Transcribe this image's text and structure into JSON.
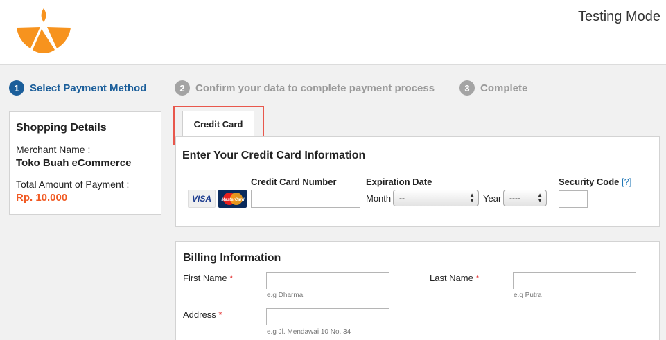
{
  "header": {
    "testing_mode": "Testing Mode",
    "logo_icon": "orange-slice-logo-icon",
    "brand_color": "#f7931e"
  },
  "steps": [
    {
      "number": "1",
      "label": "Select Payment Method",
      "state": "active"
    },
    {
      "number": "2",
      "label": "Confirm your data to complete payment process",
      "state": "inactive"
    },
    {
      "number": "3",
      "label": "Complete",
      "state": "inactive"
    }
  ],
  "shopping_details": {
    "title": "Shopping Details",
    "merchant_label": "Merchant Name :",
    "merchant_name": "Toko Buah eCommerce",
    "amount_label": "Total Amount of Payment :",
    "amount": "Rp. 10.000",
    "amount_color": "#f15a23"
  },
  "tabs": [
    {
      "label": "Credit Card",
      "selected": true
    }
  ],
  "credit_card": {
    "title": "Enter Your Credit Card Information",
    "card_number_label": "Credit Card Number",
    "card_number_value": "",
    "expiration_label": "Expiration Date",
    "month_label": "Month",
    "month_selected": "--",
    "year_label": "Year",
    "year_selected": "----",
    "security_label": "Security Code",
    "security_help": "[?]",
    "security_value": "",
    "visa_label": "VISA",
    "mastercard_label": "MasterCard"
  },
  "billing": {
    "title": "Billing Information",
    "first_name_label": "First Name",
    "first_name_hint": "e.g Dharma",
    "last_name_label": "Last Name",
    "last_name_hint": "e.g Putra",
    "address_label": "Address",
    "address_hint": "e.g Jl. Mendawai 10 No. 34",
    "required_mark": "*"
  },
  "colors": {
    "accent": "#1b5e9a",
    "inactive_step": "#a4a4a4",
    "highlight": "#e8574c",
    "required": "#e02020",
    "help_link": "#2077b6"
  }
}
